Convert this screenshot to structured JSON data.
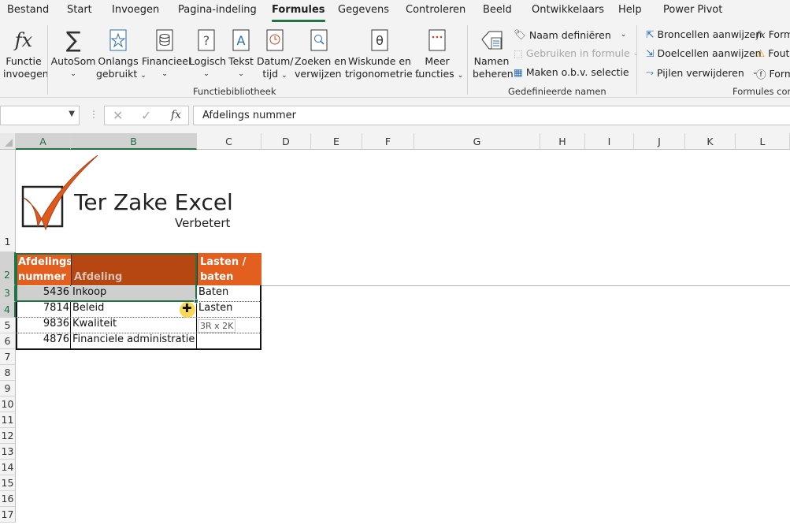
{
  "menu": {
    "items": [
      "Bestand",
      "Start",
      "Invoegen",
      "Pagina-indeling",
      "Formules",
      "Gegevens",
      "Controleren",
      "Beeld",
      "Ontwikkelaars",
      "Help",
      "Power Pivot"
    ],
    "active": "Formules"
  },
  "ribbon": {
    "insert_function": {
      "l1": "Functie",
      "l2": "invoegen"
    },
    "autosum": {
      "l1": "AutoSom"
    },
    "recent": {
      "l1": "Onlangs",
      "l2": "gebruikt"
    },
    "financial": {
      "l1": "Financieel"
    },
    "logical": {
      "l1": "Logisch"
    },
    "text": {
      "l1": "Tekst"
    },
    "datetime": {
      "l1": "Datum/",
      "l2": "tijd"
    },
    "lookup": {
      "l1": "Zoeken en",
      "l2": "verwijzen"
    },
    "math": {
      "l1": "Wiskunde en",
      "l2": "trigonometrie"
    },
    "more": {
      "l1": "Meer",
      "l2": "functies"
    },
    "group_functions": "Functiebibliotheek",
    "name_manager": {
      "l1": "Namen",
      "l2": "beheren"
    },
    "define_name": "Naam definiëren",
    "use_in_formula": "Gebruiken in formule",
    "create_from_selection": "Maken o.b.v. selectie",
    "group_names": "Gedefinieerde namen",
    "trace_precedents": "Broncellen aanwijzen",
    "trace_dependents": "Doelcellen aanwijzen",
    "remove_arrows": "Pijlen verwijderen",
    "show_formulas": "Form",
    "error_checking": "Fout",
    "evaluate_formula": "Form",
    "group_audit": "Formules cont"
  },
  "formula_bar": {
    "name_box": "",
    "formula": "Afdelings nummer"
  },
  "sheet": {
    "columns": [
      "A",
      "B",
      "C",
      "D",
      "E",
      "F",
      "G",
      "H",
      "I",
      "J",
      "K",
      "L"
    ],
    "rows": [
      "1",
      "2",
      "3",
      "4",
      "5",
      "6",
      "7",
      "8",
      "9",
      "10",
      "11",
      "12",
      "13",
      "14",
      "15",
      "16",
      "17"
    ],
    "logo": {
      "title": "Ter Zake Excel",
      "subtitle": "Verbetert"
    },
    "header": {
      "a1": "Afdelings",
      "a2": "nummer",
      "b": "Afdeling",
      "c1": "Lasten /",
      "c2": "baten"
    },
    "data": [
      {
        "nr": "5436",
        "afd": "Inkoop",
        "type": "Baten"
      },
      {
        "nr": "7814",
        "afd": "Beleid",
        "type": "Lasten"
      },
      {
        "nr": "9836",
        "afd": "Kwaliteit",
        "type": ""
      },
      {
        "nr": "4876",
        "afd": "Financiele administratie",
        "type": ""
      }
    ],
    "drag_tooltip": "3R x 2K"
  },
  "colors": {
    "accent_green": "#217346",
    "orange": "#e35f1f",
    "dark_orange": "#b64612",
    "text_gray": "#a6a6a6"
  }
}
